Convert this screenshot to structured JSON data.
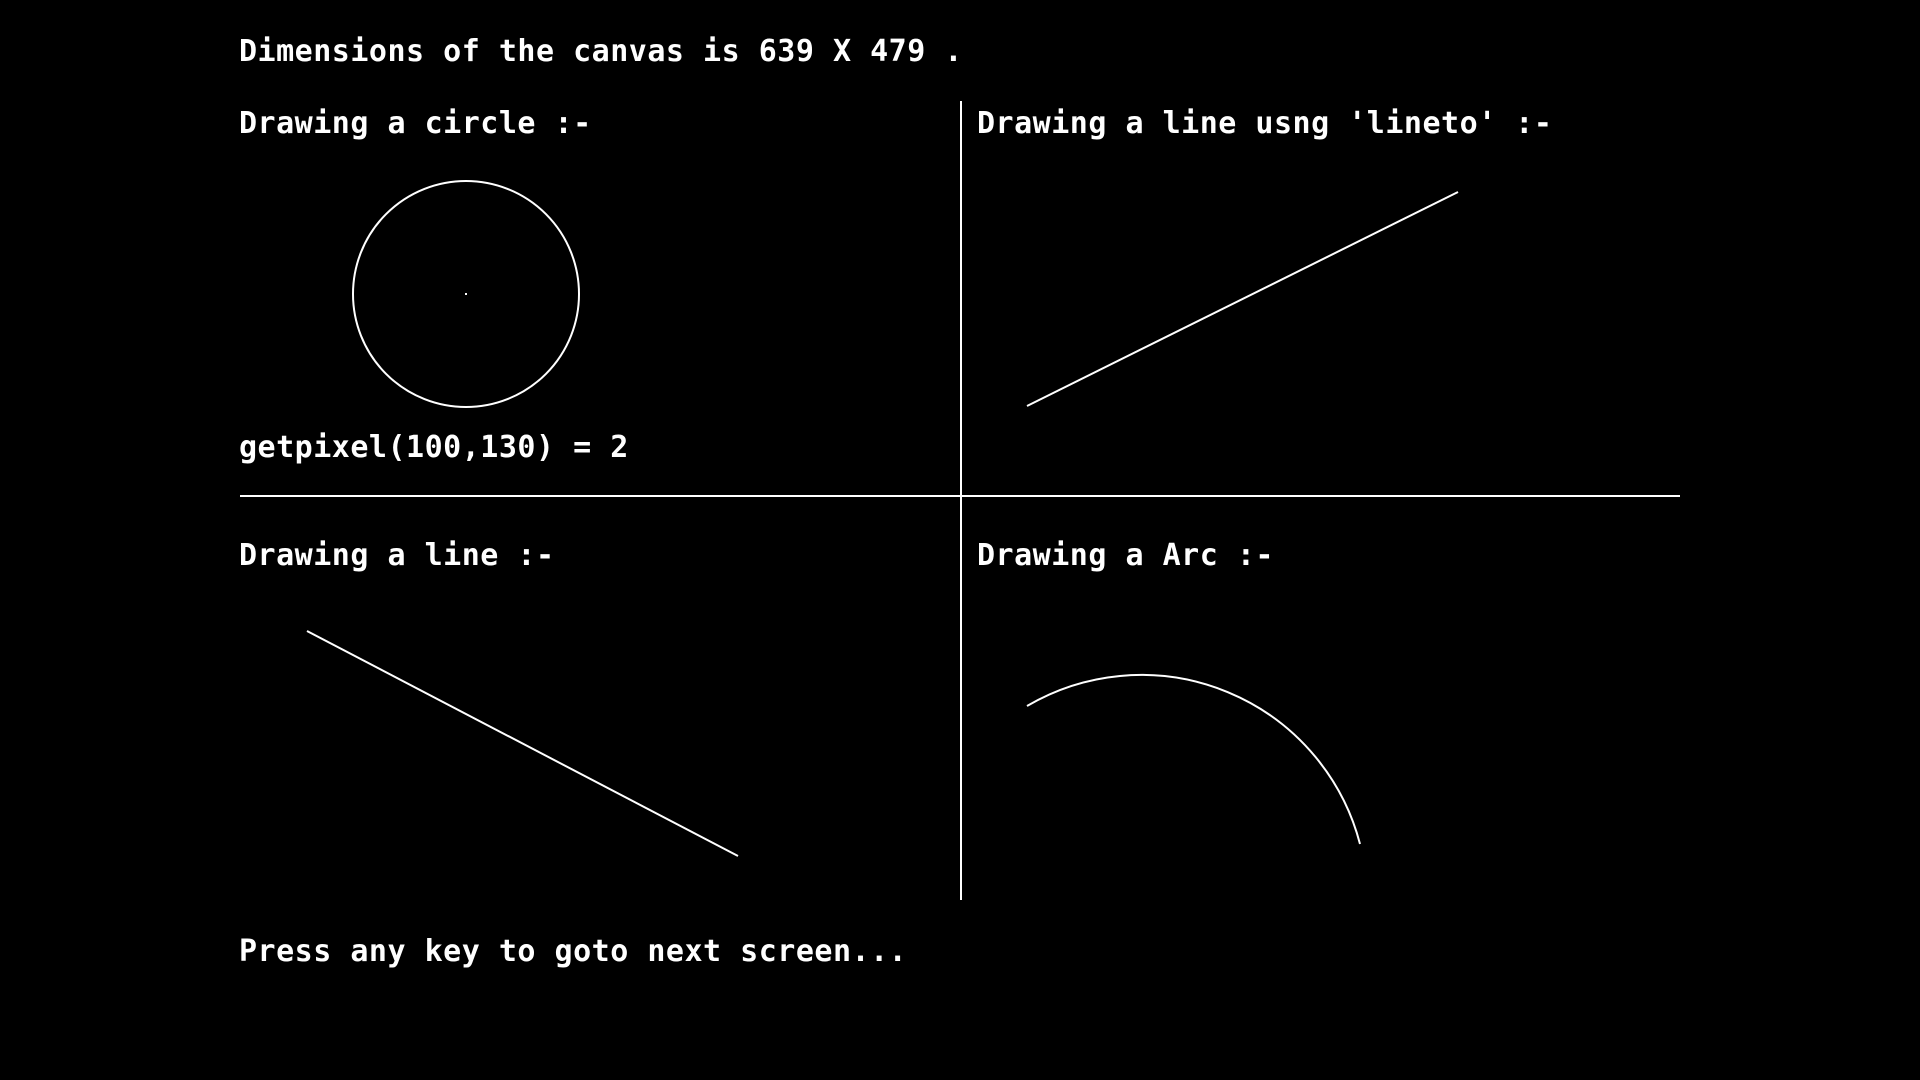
{
  "header": {
    "dimensions_text": "Dimensions of the canvas is 639 X 479 ."
  },
  "panels": {
    "circle": {
      "label": "Drawing a circle :-",
      "getpixel_text": "getpixel(100,130) = 2"
    },
    "lineto": {
      "label": "Drawing a line usng 'lineto' :-"
    },
    "line": {
      "label": "Drawing a line :-"
    },
    "arc": {
      "label": "Drawing a Arc :-"
    }
  },
  "footer": {
    "prompt_text": "Press any key to goto next screen..."
  },
  "colors": {
    "background": "#000000",
    "foreground": "#ffffff"
  }
}
